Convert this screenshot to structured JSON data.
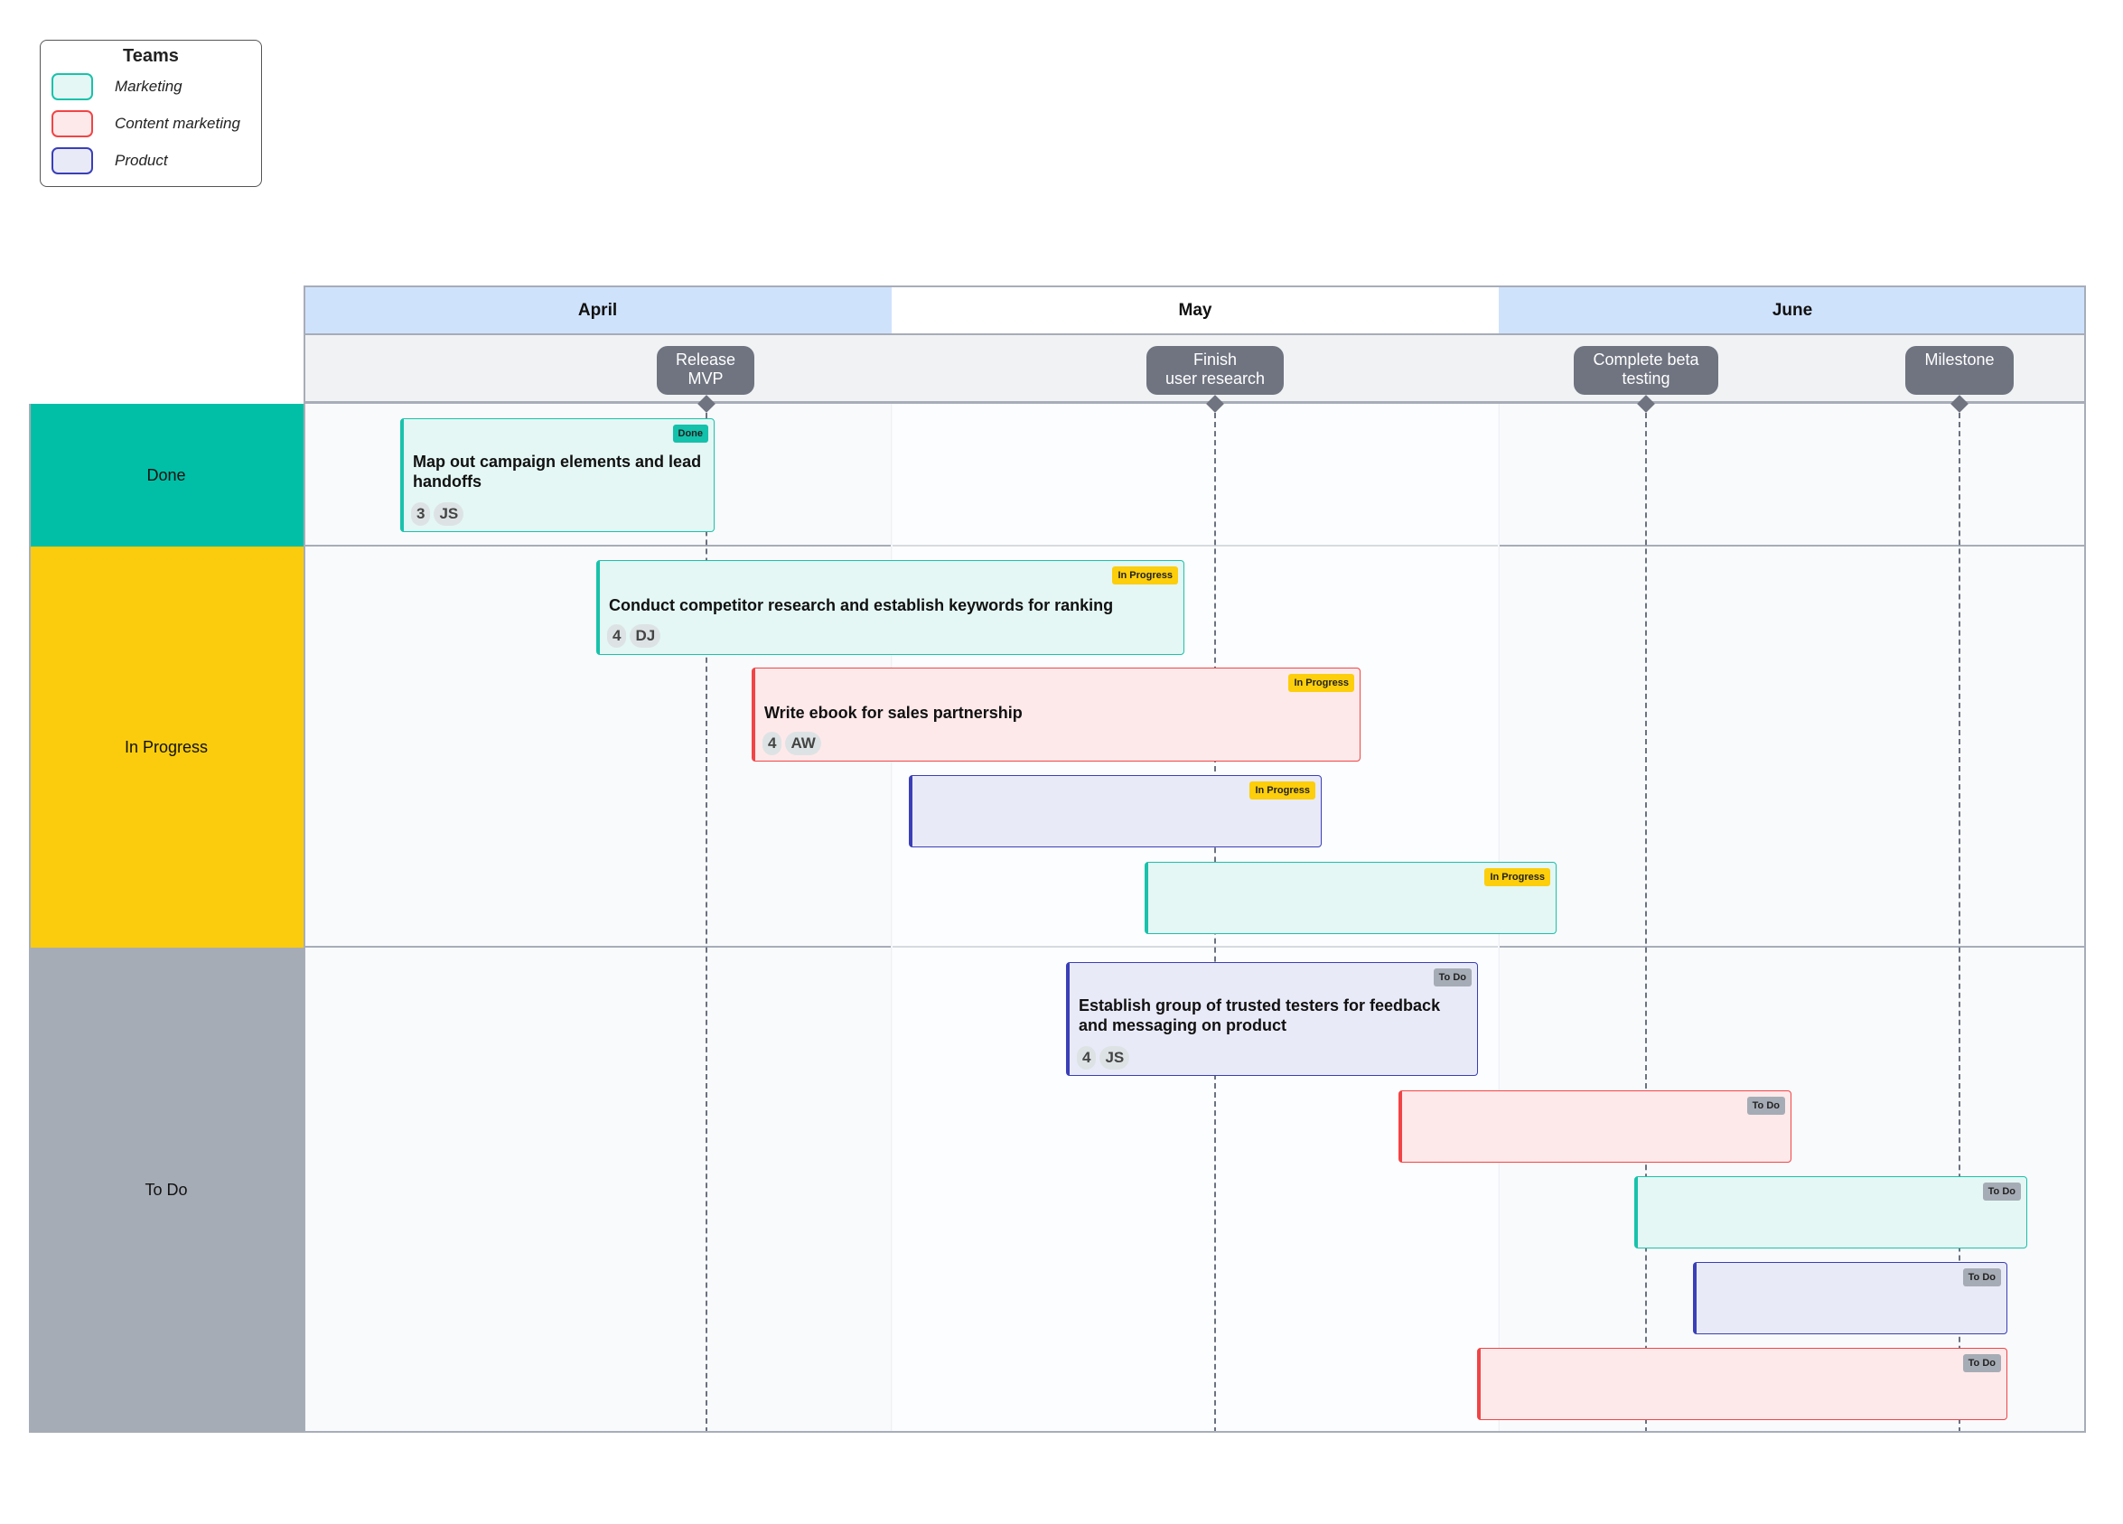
{
  "legend": {
    "title": "Teams",
    "items": [
      {
        "label": "Marketing",
        "fill": "#e4f7f4",
        "stroke": "#19c2ab"
      },
      {
        "label": "Content marketing",
        "fill": "#fee9ea",
        "stroke": "#f14446"
      },
      {
        "label": "Product",
        "fill": "#e9eaf8",
        "stroke": "#3a3fb8"
      }
    ]
  },
  "months": [
    "April",
    "May",
    "June"
  ],
  "milestones": [
    {
      "label": "Release MVP"
    },
    {
      "label": "Finish user research"
    },
    {
      "label": "Complete beta testing"
    },
    {
      "label": "Milestone"
    }
  ],
  "lanes": [
    {
      "label": "Done",
      "color": "#00bfa6"
    },
    {
      "label": "In Progress",
      "color": "#facc0d"
    },
    {
      "label": "To Do",
      "color": "#a6acb5"
    }
  ],
  "tasks": [
    {
      "title": "Map out campaign elements and lead handoffs",
      "status": "Done",
      "team": "Marketing",
      "points": "3",
      "assignee": "JS"
    },
    {
      "title": "Conduct competitor research and establish keywords for ranking",
      "status": "In Progress",
      "team": "Marketing",
      "points": "4",
      "assignee": "DJ"
    },
    {
      "title": "Write ebook for sales partnership",
      "status": "In Progress",
      "team": "Content marketing",
      "points": "4",
      "assignee": "AW"
    },
    {
      "title": "",
      "status": "In Progress",
      "team": "Product"
    },
    {
      "title": "",
      "status": "In Progress",
      "team": "Marketing"
    },
    {
      "title": "Establish group of trusted testers for feedback and messaging on product",
      "status": "To Do",
      "team": "Product",
      "points": "4",
      "assignee": "JS"
    },
    {
      "title": "",
      "status": "To Do",
      "team": "Content marketing"
    },
    {
      "title": "",
      "status": "To Do",
      "team": "Marketing"
    },
    {
      "title": "",
      "status": "To Do",
      "team": "Product"
    },
    {
      "title": "",
      "status": "To Do",
      "team": "Content marketing"
    }
  ]
}
